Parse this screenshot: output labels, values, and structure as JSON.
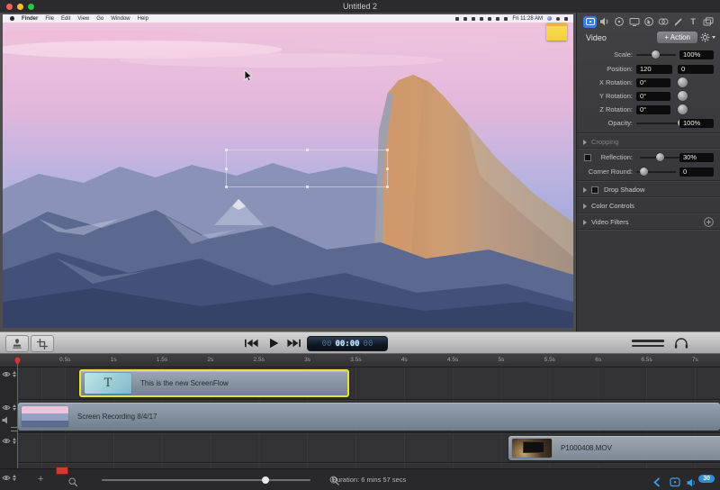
{
  "window": {
    "title": "Untitled 2"
  },
  "preview": {
    "menubar": {
      "items": [
        "Finder",
        "File",
        "Edit",
        "View",
        "Go",
        "Window",
        "Help"
      ],
      "clock": "Fri 11:28 AM"
    }
  },
  "inspector": {
    "tabs": [
      "video",
      "audio",
      "video-motion",
      "screen-recording",
      "callout",
      "touch-callout",
      "annotations",
      "text",
      "media-library"
    ],
    "text_tab_glyph": "T",
    "header": {
      "title": "Video",
      "action_label": "+ Action"
    },
    "rows": {
      "scale": {
        "label": "Scale:",
        "value": "100%"
      },
      "position": {
        "label": "Position:",
        "x": "120",
        "y": "0"
      },
      "x_rotation": {
        "label": "X Rotation:",
        "value": "0°"
      },
      "y_rotation": {
        "label": "Y Rotation:",
        "value": "0°"
      },
      "z_rotation": {
        "label": "Z Rotation:",
        "value": "0°"
      },
      "opacity": {
        "label": "Opacity:",
        "value": "100%"
      }
    },
    "sections": {
      "cropping": {
        "label": "Cropping"
      },
      "reflection": {
        "label": "Reflection:",
        "value": "30%"
      },
      "corner_round": {
        "label": "Corner Round:",
        "value": "0"
      },
      "drop_shadow": {
        "label": "Drop Shadow"
      },
      "color_controls": {
        "label": "Color Controls"
      },
      "video_filters": {
        "label": "Video Filters"
      }
    }
  },
  "transport": {
    "timecode": {
      "hours": "00",
      "main": "00:00",
      "frames": "00"
    }
  },
  "timeline": {
    "ruler": {
      "ticks": [
        "0.5s",
        "1s",
        "1.5s",
        "2s",
        "2.5s",
        "3s",
        "3.5s",
        "4s",
        "4.5s",
        "5s",
        "5.5s",
        "6s",
        "6.5s",
        "7s"
      ]
    },
    "clips": [
      {
        "name": "text-clip",
        "label": "This is the new ScreenFlow",
        "thumb_glyph": "T",
        "selected": true
      },
      {
        "name": "screen-recording-clip",
        "label": "Screen Recording 8/4/17"
      },
      {
        "name": "movie-clip",
        "label": "P1000408.MOV"
      }
    ],
    "status": {
      "plus": "+",
      "duration": "Duration: 6 mins 57 secs",
      "fps_badge": "30"
    }
  },
  "colors": {
    "accent_blue": "#3b7ce0",
    "selection_yellow": "#e6e335",
    "playhead_red": "#d23a30",
    "status_icon_blue": "#3ba0e8",
    "sticky_yellow": "#f7d94c"
  }
}
